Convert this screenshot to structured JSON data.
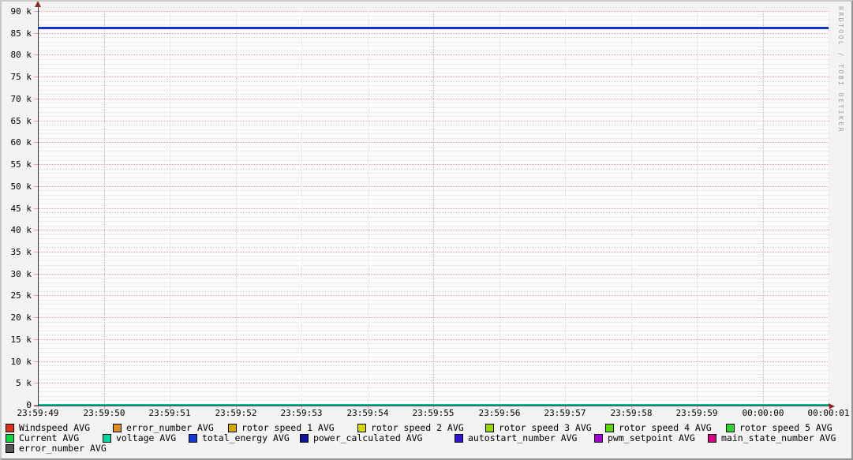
{
  "watermark": "RRDTOOL / TOBI OETIKER",
  "chart_data": {
    "type": "line",
    "title": "",
    "xlabel": "",
    "ylabel": "",
    "x_axis": {
      "labels": [
        "23:59:49",
        "23:59:50",
        "23:59:51",
        "23:59:52",
        "23:59:53",
        "23:59:54",
        "23:59:55",
        "23:59:56",
        "23:59:57",
        "23:59:58",
        "23:59:59",
        "00:00:00",
        "00:00:01"
      ],
      "major_gridline_indices": [
        1,
        6,
        11
      ]
    },
    "y_axis": {
      "tick_labels": [
        "90 k",
        "85 k",
        "80 k",
        "75 k",
        "70 k",
        "65 k",
        "60 k",
        "55 k",
        "50 k",
        "45 k",
        "40 k",
        "35 k",
        "30 k",
        "25 k",
        "20 k",
        "15 k",
        "10 k",
        "5 k",
        "0"
      ],
      "min": 0,
      "max": 90000,
      "major_step": 5000,
      "minor_step": 1000
    },
    "grid": {
      "style": "dotted",
      "major_color": "#ef9f9f",
      "minor_color": "#dcdcdc"
    },
    "series": [
      {
        "name": "total_energy AVG",
        "shape": "hline",
        "value": 86200,
        "color": "#1135cc",
        "thickness": 3
      },
      {
        "name": "voltage AVG",
        "shape": "hline",
        "value": 0,
        "color": "#00bf97",
        "thickness": 2
      }
    ],
    "legend": {
      "rows": [
        {
          "top": 536,
          "items": [
            {
              "label": "Windspeed AVG",
              "color": "#e03118",
              "x": 7
            },
            {
              "label": "error_number AVG",
              "color": "#e08a20",
              "x": 143
            },
            {
              "label": "rotor speed 1 AVG",
              "color": "#d7a900",
              "x": 289
            },
            {
              "label": "rotor speed 2 AVG",
              "color": "#d9d900",
              "x": 453
            },
            {
              "label": "rotor speed 3 AVG",
              "color": "#97d700",
              "x": 615
            },
            {
              "label": "rotor speed 4 AVG",
              "color": "#5bd700",
              "x": 767
            },
            {
              "label": "rotor speed 5 AVG",
              "color": "#2bd72b",
              "x": 920
            }
          ]
        },
        {
          "top": 549,
          "items": [
            {
              "label": "Current AVG",
              "color": "#0fd73c",
              "x": 7
            },
            {
              "label": "voltage AVG",
              "color": "#00d7a0",
              "x": 130
            },
            {
              "label": "total_energy AVG",
              "color": "#1438d7",
              "x": 239
            },
            {
              "label": "power_calculated AVG",
              "color": "#10109b",
              "x": 380
            },
            {
              "label": "autostart_number AVG",
              "color": "#3213ce",
              "x": 576
            },
            {
              "label": "pwm_setpoint AVG",
              "color": "#a500d7",
              "x": 753
            },
            {
              "label": "main_state_number AVG",
              "color": "#d7008c",
              "x": 897
            }
          ]
        },
        {
          "top": 562,
          "items": [
            {
              "label": "error_number AVG",
              "color": "#575757",
              "x": 7
            }
          ]
        }
      ]
    }
  }
}
